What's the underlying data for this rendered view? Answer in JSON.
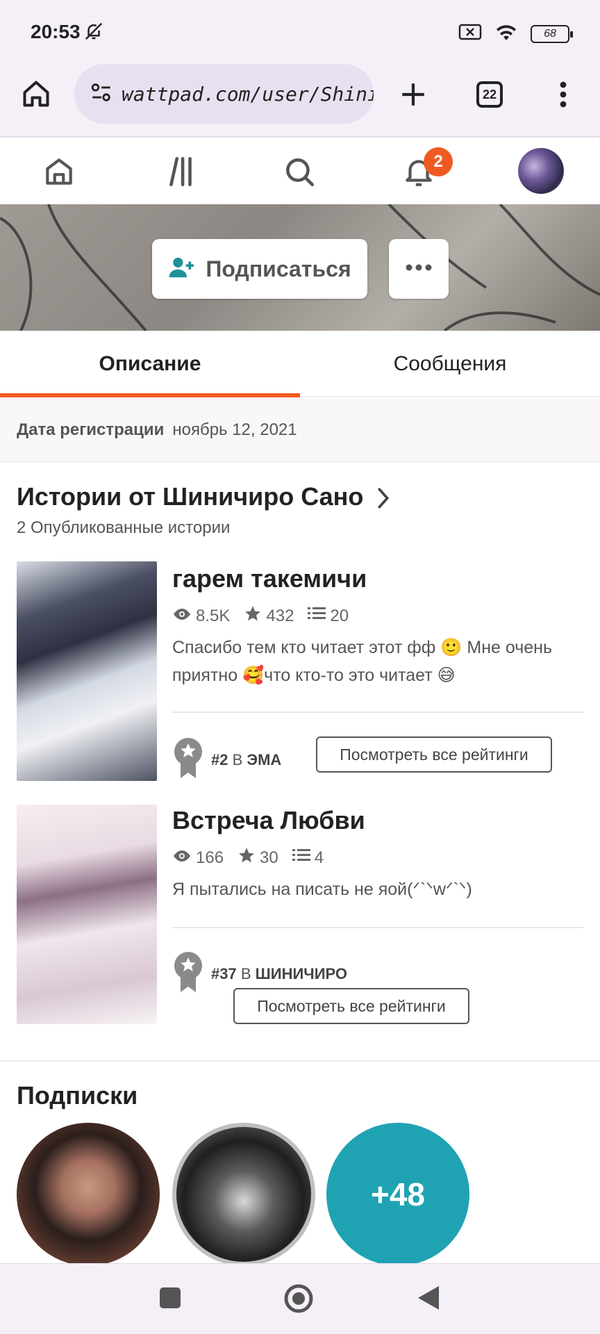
{
  "status_bar": {
    "time": "20:53",
    "battery": "68"
  },
  "browser": {
    "url": "wattpad.com/user/Shinich",
    "tab_count": "22"
  },
  "nav": {
    "notification_count": "2"
  },
  "profile": {
    "follow_label": "Подписаться",
    "tabs": [
      {
        "label": "Описание"
      },
      {
        "label": "Сообщения"
      }
    ],
    "registration_label": "Дата регистрации",
    "registration_date": "ноябрь 12, 2021"
  },
  "stories": {
    "title": "Истории от Шиничиро Сано",
    "subtitle": "2 Опубликованные истории",
    "items": [
      {
        "title": "гарем такемичи",
        "reads": "8.5K",
        "votes": "432",
        "parts": "20",
        "description": "Спасибо тем кто читает этот фф 🙂 Мне очень приятно 🥰что кто-то это читает 😅",
        "rank_num": "#2",
        "rank_in": "В",
        "rank_tag": "ЭМА",
        "rank_button": "Посмотреть все рейтинги"
      },
      {
        "title": "Встреча Любви",
        "reads": "166",
        "votes": "30",
        "parts": "4",
        "description": "Я пытались на писать не яой(ᐟ`ᐠᴡᐟ`ᐠ)",
        "rank_num": "#37",
        "rank_in": "В",
        "rank_tag": "ШИНИЧИРО",
        "rank_button": "Посмотреть все рейтинги"
      }
    ]
  },
  "subscriptions": {
    "title": "Подписки",
    "more_count": "+48"
  },
  "colors": {
    "accent": "#f05a22",
    "teal": "#1fa3b3",
    "follow_icon": "#1f8f9a"
  }
}
